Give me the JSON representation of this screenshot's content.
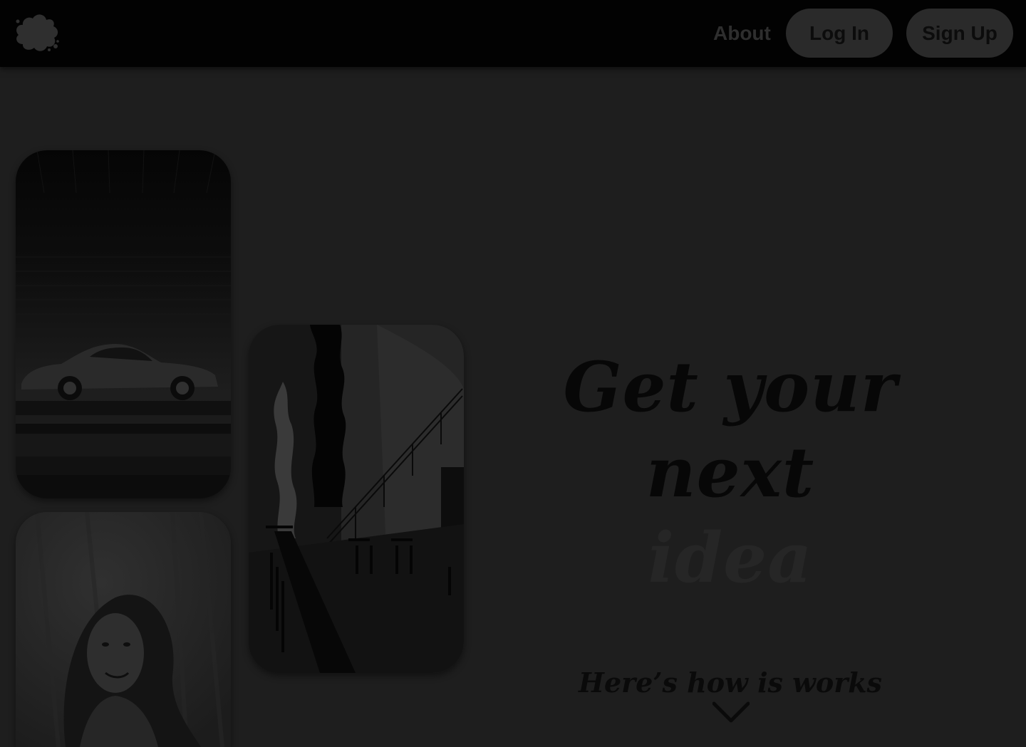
{
  "header": {
    "logo_icon": "paint-splat-logo-icon",
    "nav": {
      "about_label": "About"
    },
    "buttons": {
      "login_label": "Log In",
      "signup_label": "Sign Up"
    }
  },
  "hero": {
    "headline_line1": "Get your next",
    "headline_line2": "idea",
    "cta_text": "Here’s how is works",
    "scroll_icon": "chevron-down-icon"
  },
  "gallery": {
    "images": [
      {
        "subject": "classic-sports-car-photo"
      },
      {
        "subject": "modern-interior-staircase-photo"
      },
      {
        "subject": "smiling-woman-portrait-photo"
      }
    ]
  },
  "colors": {
    "page_background": "#1e1e1e",
    "header_background": "#020202",
    "button_background": "#2a2a2a",
    "headline_primary": "#070707",
    "headline_secondary": "#262626"
  }
}
